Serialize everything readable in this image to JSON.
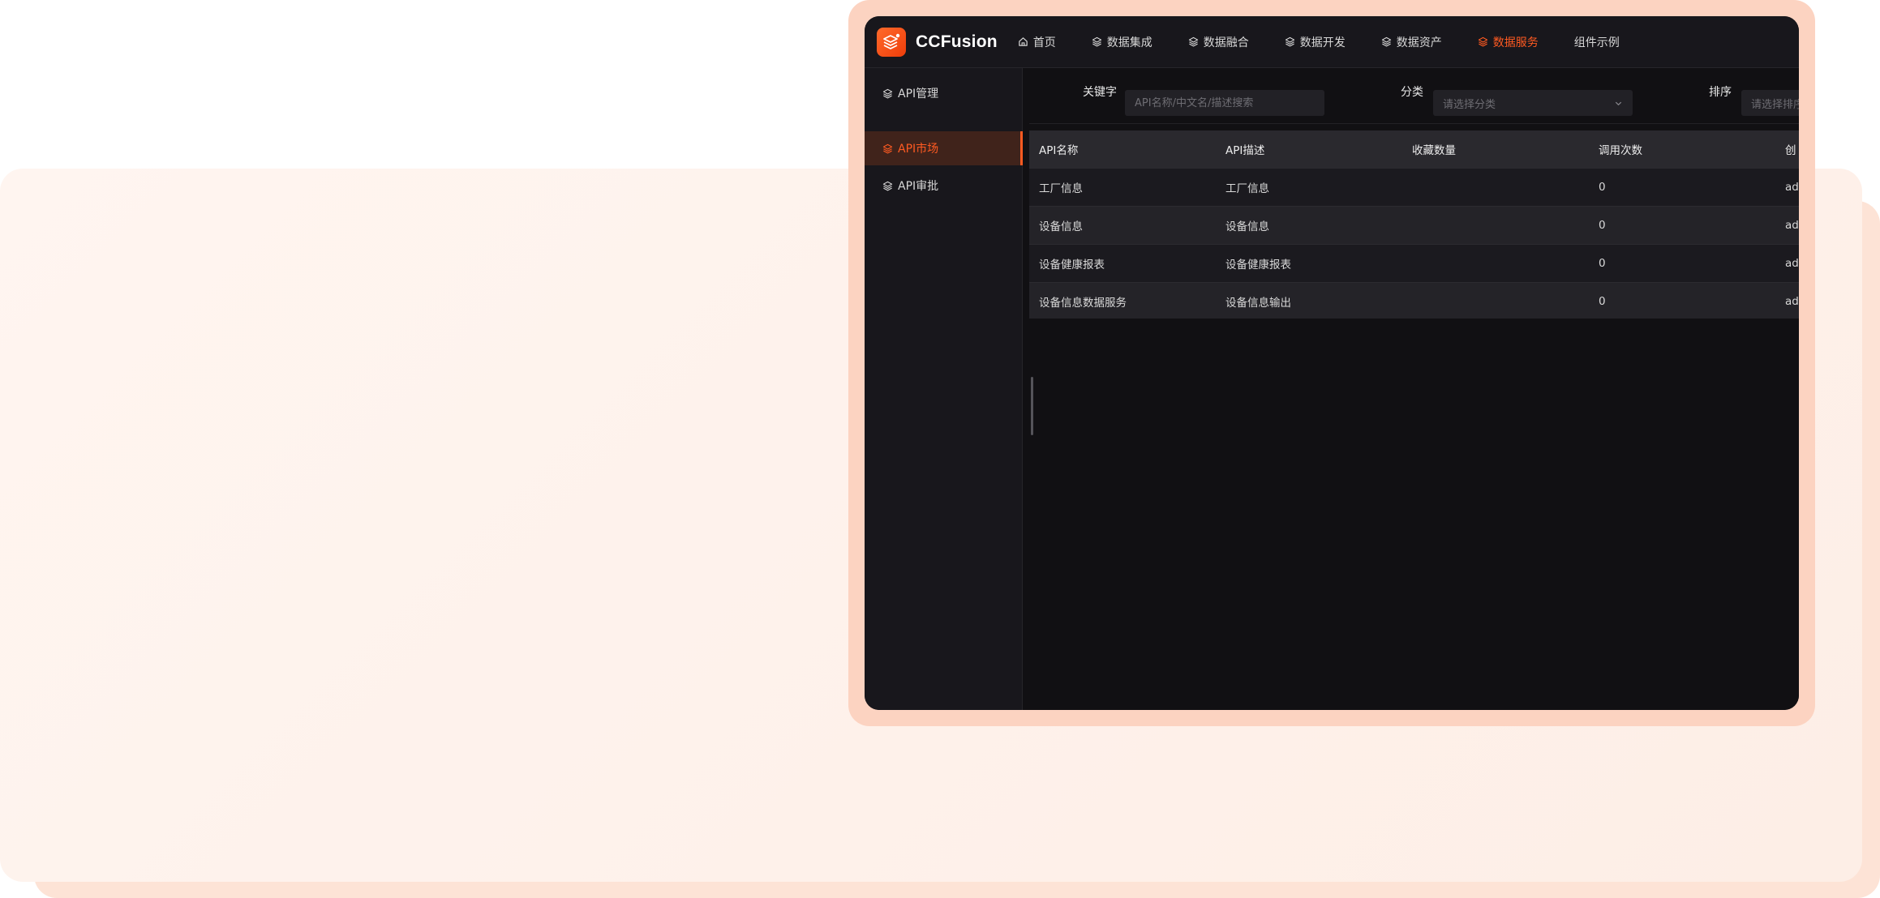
{
  "brand": {
    "name": "CCFusion",
    "accent": "#ff5a21"
  },
  "nav": [
    {
      "label": "首页",
      "icon": "home-icon"
    },
    {
      "label": "数据集成",
      "icon": "layers-icon"
    },
    {
      "label": "数据融合",
      "icon": "layers-icon"
    },
    {
      "label": "数据开发",
      "icon": "layers-icon"
    },
    {
      "label": "数据资产",
      "icon": "layers-icon"
    },
    {
      "label": "数据服务",
      "icon": "layers-icon",
      "active": true
    },
    {
      "label": "组件示例"
    }
  ],
  "sidebar": {
    "items": [
      {
        "label": "API管理",
        "icon": "layers-icon"
      },
      {
        "label": "API市场",
        "icon": "layers-icon",
        "active": true
      },
      {
        "label": "API审批",
        "icon": "layers-icon"
      }
    ]
  },
  "filters": {
    "keyword_label": "关键字",
    "keyword_placeholder": "API名称/中文名/描述搜索",
    "category_label": "分类",
    "category_placeholder": "请选择分类",
    "sort_label": "排序",
    "sort_placeholder": "请选择排序"
  },
  "table": {
    "columns": [
      "API名称",
      "API描述",
      "收藏数量",
      "调用次数",
      "创"
    ],
    "rows": [
      {
        "name": "工厂信息",
        "desc": "工厂信息",
        "fav": "",
        "calls": "0",
        "creator": "ad"
      },
      {
        "name": "设备信息",
        "desc": "设备信息",
        "fav": "",
        "calls": "0",
        "creator": "ad"
      },
      {
        "name": "设备健康报表",
        "desc": "设备健康报表",
        "fav": "",
        "calls": "0",
        "creator": "ad"
      },
      {
        "name": "设备信息数据服务",
        "desc": "设备信息输出",
        "fav": "",
        "calls": "0",
        "creator": "ad"
      }
    ]
  }
}
